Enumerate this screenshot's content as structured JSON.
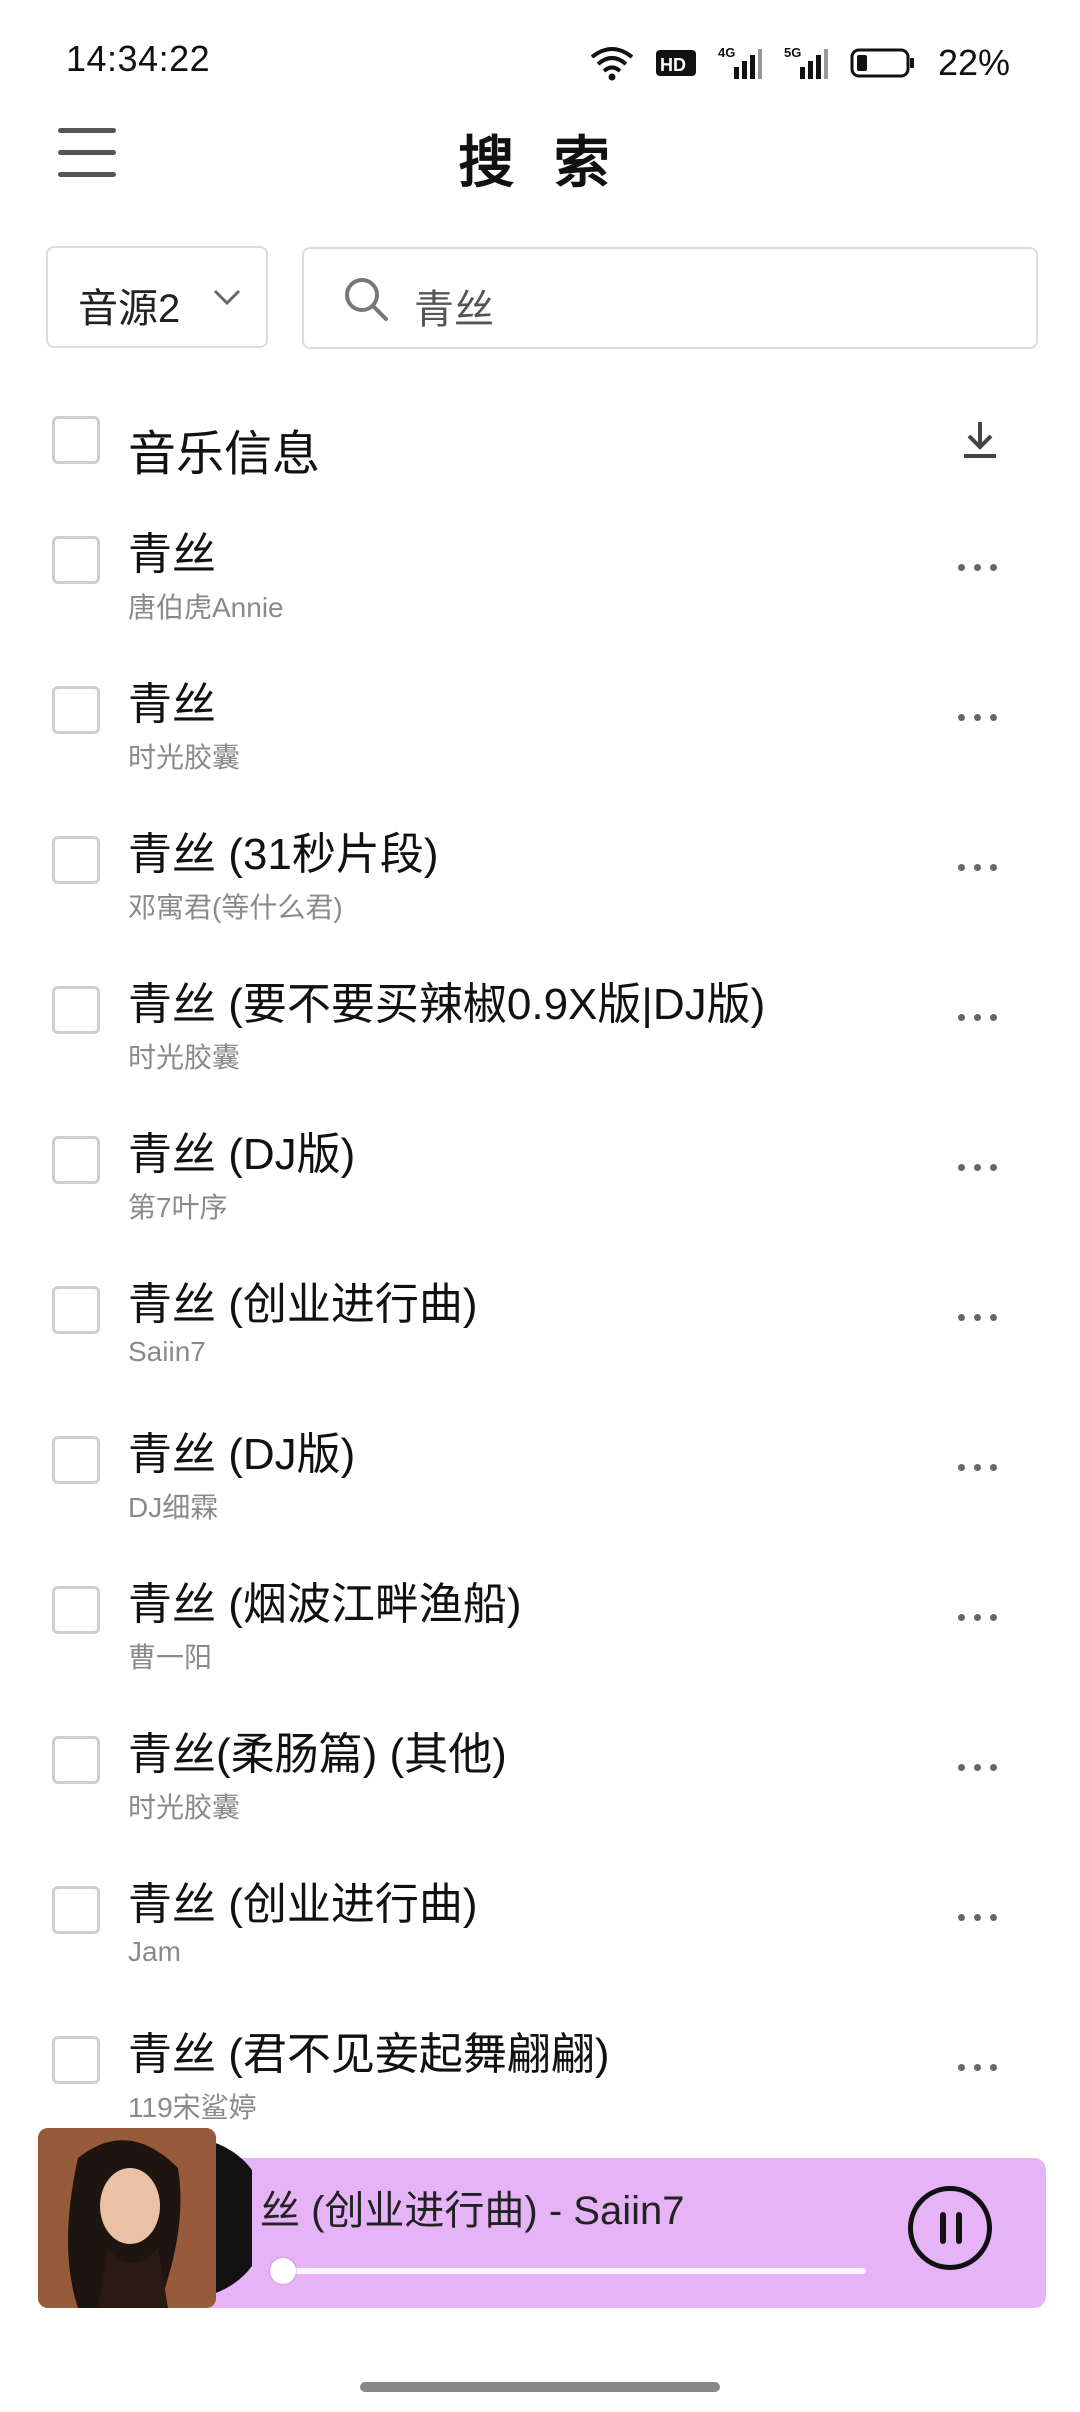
{
  "status": {
    "time": "14:34:22",
    "battery": "22%",
    "icons": [
      "wifi-icon",
      "hd-icon",
      "signal-4g-icon",
      "signal-5g-icon",
      "battery-icon"
    ]
  },
  "header": {
    "title": "搜 索",
    "menu_icon": "menu-icon"
  },
  "search": {
    "source_label": "音源2",
    "query": "青丝"
  },
  "list_header": {
    "label": "音乐信息",
    "download_icon": "download-icon"
  },
  "songs": [
    {
      "title": "青丝",
      "artist": "唐伯虎Annie"
    },
    {
      "title": "青丝",
      "artist": "时光胶囊"
    },
    {
      "title": "青丝 (31秒片段)",
      "artist": "邓寓君(等什么君)"
    },
    {
      "title": "青丝 (要不要买辣椒0.9X版|DJ版)",
      "artist": "时光胶囊"
    },
    {
      "title": "青丝 (DJ版)",
      "artist": "第7叶序"
    },
    {
      "title": "青丝 (创业进行曲)",
      "artist": "Saiin7"
    },
    {
      "title": "青丝 (DJ版)",
      "artist": "DJ细霖"
    },
    {
      "title": "青丝 (烟波江畔渔船)",
      "artist": "曹一阳"
    },
    {
      "title": "青丝(柔肠篇) (其他)",
      "artist": "时光胶囊"
    },
    {
      "title": "青丝 (创业进行曲)",
      "artist": "Jam"
    },
    {
      "title": "青丝 (君不见妾起舞翩翩)",
      "artist": "119宋鲨婷"
    }
  ],
  "player": {
    "now_playing": "丝 (创业进行曲) - Saiin7",
    "progress": 0.0,
    "accent": "#e6b3f7",
    "pause_icon": "pause-icon"
  }
}
